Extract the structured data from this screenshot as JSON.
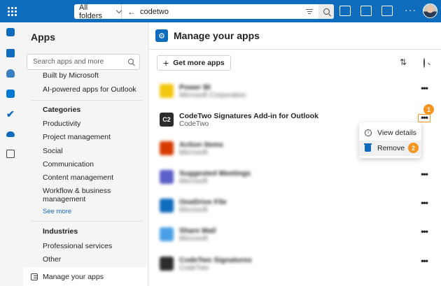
{
  "topbar": {
    "search_scope": "All folders",
    "search_value": "codetwo"
  },
  "apps_panel": {
    "title": "Apps",
    "search_placeholder": "Search apps and more",
    "items_top": [
      "Built by Microsoft",
      "AI-powered apps for Outlook"
    ],
    "categories_heading": "Categories",
    "categories": [
      "Productivity",
      "Project management",
      "Social",
      "Communication",
      "Content management",
      "Workflow & business management"
    ],
    "see_more": "See more",
    "industries_heading": "Industries",
    "industries": [
      "Professional services",
      "Other"
    ],
    "manage_label": "Manage your apps"
  },
  "main": {
    "title": "Manage your apps",
    "get_more_label": "Get more apps",
    "apps": [
      {
        "name": "Power BI",
        "publisher": "Microsoft Corporation",
        "blurred": true,
        "color": "#f2c811"
      },
      {
        "name": "CodeTwo Signatures Add-in for Outlook",
        "publisher": "CodeTwo",
        "blurred": false,
        "color": "#2c2c2c",
        "logo_text": "C2"
      },
      {
        "name": "Action Items",
        "publisher": "Microsoft",
        "blurred": true,
        "color": "#d83b01"
      },
      {
        "name": "Suggested Meetings",
        "publisher": "Microsoft",
        "blurred": true,
        "color": "#5b5fc7"
      },
      {
        "name": "OneDrive File",
        "publisher": "Microsoft",
        "blurred": true,
        "color": "#0f6cbd"
      },
      {
        "name": "Share Mail",
        "publisher": "Microsoft",
        "blurred": true,
        "color": "#4aa0e6"
      },
      {
        "name": "CodeTwo Signatures",
        "publisher": "CodeTwo",
        "blurred": true,
        "color": "#2c2c2c"
      }
    ],
    "menu": {
      "view_details": "View details",
      "remove": "Remove"
    },
    "callouts": [
      "1",
      "2"
    ]
  },
  "colors": {
    "brand": "#0f6cbd",
    "callout": "#f7941d"
  }
}
